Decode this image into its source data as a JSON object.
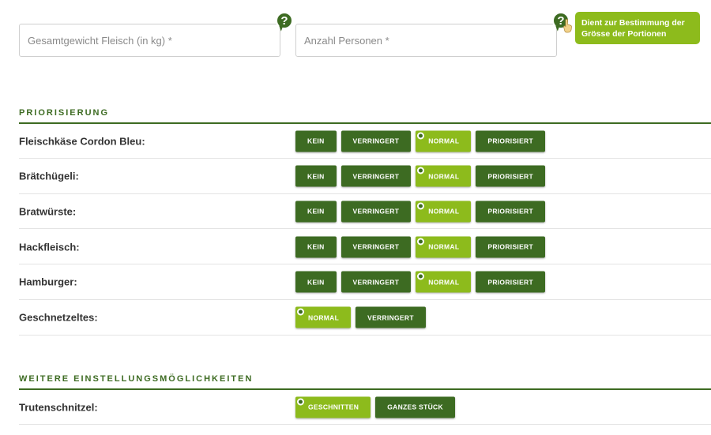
{
  "inputs": {
    "weight_placeholder": "Gesamtgewicht Fleisch (in kg) *",
    "persons_placeholder": "Anzahl Personen *"
  },
  "help": {
    "icon": "?",
    "tooltip": "Dient zur Bestimmung der Grösse der Portionen"
  },
  "sections": {
    "priorisierung": "PRIORISIERUNG",
    "weitere": "WEITERE EINSTELLUNGSMÖGLICHKEITEN"
  },
  "rows": [
    {
      "label": "Fleischkäse Cordon Bleu:",
      "options": [
        "KEIN",
        "VERRINGERT",
        "NORMAL",
        "PRIORISIERT"
      ],
      "selected": "NORMAL"
    },
    {
      "label": "Brätchügeli:",
      "options": [
        "KEIN",
        "VERRINGERT",
        "NORMAL",
        "PRIORISIERT"
      ],
      "selected": "NORMAL"
    },
    {
      "label": "Bratwürste:",
      "options": [
        "KEIN",
        "VERRINGERT",
        "NORMAL",
        "PRIORISIERT"
      ],
      "selected": "NORMAL"
    },
    {
      "label": "Hackfleisch:",
      "options": [
        "KEIN",
        "VERRINGERT",
        "NORMAL",
        "PRIORISIERT"
      ],
      "selected": "NORMAL"
    },
    {
      "label": "Hamburger:",
      "options": [
        "KEIN",
        "VERRINGERT",
        "NORMAL",
        "PRIORISIERT"
      ],
      "selected": "NORMAL"
    },
    {
      "label": "Geschnetzeltes:",
      "options": [
        "NORMAL",
        "VERRINGERT"
      ],
      "selected": "NORMAL"
    }
  ],
  "extra_rows": [
    {
      "label": "Trutenschnitzel:",
      "options": [
        "GESCHNITTEN",
        "GANZES STÜCK"
      ],
      "selected": "GESCHNITTEN"
    }
  ],
  "colors": {
    "primary": "#3d6b22",
    "accent": "#8dbb1c"
  }
}
